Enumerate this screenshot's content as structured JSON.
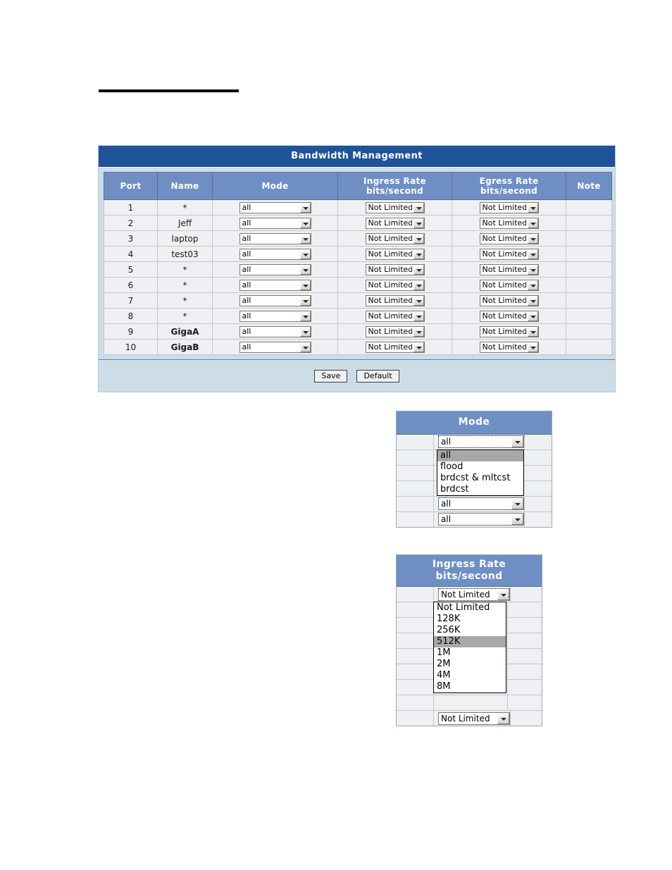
{
  "colors": {
    "title_bar": "#1f5398",
    "column_header": "#6f8fc4",
    "panel_bg": "#cddde8",
    "row_bg": "#eef0f2",
    "option_highlight": "#a8a8a8"
  },
  "panel": {
    "title": "Bandwidth Management",
    "columns": [
      {
        "label": "Port"
      },
      {
        "label": "Name"
      },
      {
        "label": "Mode"
      },
      {
        "label_line1": "Ingress Rate",
        "label_line2": "bits/second"
      },
      {
        "label_line1": "Egress Rate",
        "label_line2": "bits/second"
      },
      {
        "label": "Note"
      }
    ],
    "rows": [
      {
        "port": "1",
        "name": "*",
        "name_bold": false,
        "mode": "all",
        "ingress": "Not Limited",
        "egress": "Not Limited",
        "note": ""
      },
      {
        "port": "2",
        "name": "Jeff",
        "name_bold": false,
        "mode": "all",
        "ingress": "Not Limited",
        "egress": "Not Limited",
        "note": ""
      },
      {
        "port": "3",
        "name": "laptop",
        "name_bold": false,
        "mode": "all",
        "ingress": "Not Limited",
        "egress": "Not Limited",
        "note": ""
      },
      {
        "port": "4",
        "name": "test03",
        "name_bold": false,
        "mode": "all",
        "ingress": "Not Limited",
        "egress": "Not Limited",
        "note": ""
      },
      {
        "port": "5",
        "name": "*",
        "name_bold": false,
        "mode": "all",
        "ingress": "Not Limited",
        "egress": "Not Limited",
        "note": ""
      },
      {
        "port": "6",
        "name": "*",
        "name_bold": false,
        "mode": "all",
        "ingress": "Not Limited",
        "egress": "Not Limited",
        "note": ""
      },
      {
        "port": "7",
        "name": "*",
        "name_bold": false,
        "mode": "all",
        "ingress": "Not Limited",
        "egress": "Not Limited",
        "note": ""
      },
      {
        "port": "8",
        "name": "*",
        "name_bold": false,
        "mode": "all",
        "ingress": "Not Limited",
        "egress": "Not Limited",
        "note": ""
      },
      {
        "port": "9",
        "name": "GigaA",
        "name_bold": true,
        "mode": "all",
        "ingress": "Not Limited",
        "egress": "Not Limited",
        "note": ""
      },
      {
        "port": "10",
        "name": "GigaB",
        "name_bold": true,
        "mode": "all",
        "ingress": "Not Limited",
        "egress": "Not Limited",
        "note": ""
      }
    ],
    "buttons": {
      "save": "Save",
      "default": "Default"
    }
  },
  "mode_detail": {
    "header": "Mode",
    "selected": "all",
    "occluded_value": "all",
    "trailing_value": "all",
    "options": [
      {
        "label": "all",
        "highlighted": true
      },
      {
        "label": "flood",
        "highlighted": false
      },
      {
        "label": "brdcst & mltcst",
        "highlighted": false
      },
      {
        "label": "brdcst",
        "highlighted": false
      }
    ]
  },
  "ingress_detail": {
    "header_line1": "Ingress Rate",
    "header_line2": "bits/second",
    "selected": "Not Limited",
    "trailing_value": "Not Limited",
    "options": [
      {
        "label": "Not Limited",
        "highlighted": false
      },
      {
        "label": "128K",
        "highlighted": false
      },
      {
        "label": "256K",
        "highlighted": false
      },
      {
        "label": "512K",
        "highlighted": true
      },
      {
        "label": "1M",
        "highlighted": false
      },
      {
        "label": "2M",
        "highlighted": false
      },
      {
        "label": "4M",
        "highlighted": false
      },
      {
        "label": "8M",
        "highlighted": false
      }
    ]
  }
}
